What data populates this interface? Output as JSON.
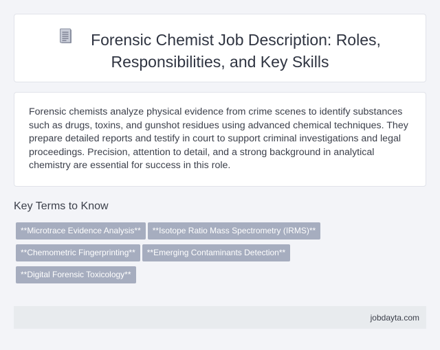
{
  "header": {
    "icon": "document-icon",
    "title_line1": "Forensic Chemist Job Description: Roles,",
    "title_line2": "Responsibilities, and Key Skills"
  },
  "description": {
    "text": "Forensic chemists analyze physical evidence from crime scenes to identify substances such as drugs, toxins, and gunshot residues using advanced chemical techniques. They prepare detailed reports and testify in court to support criminal investigations and legal proceedings. Precision, attention to detail, and a strong background in analytical chemistry are essential for success in this role."
  },
  "key_terms": {
    "heading": "Key Terms to Know",
    "tags": [
      "**Microtrace Evidence Analysis**",
      "**Isotope Ratio Mass Spectrometry (IRMS)**",
      "**Chemometric Fingerprinting**",
      "**Emerging Contaminants Detection**",
      "**Digital Forensic Toxicology**"
    ]
  },
  "footer": {
    "site": "jobdayta.com"
  },
  "colors": {
    "background": "#f3f4f8",
    "tag_bg": "#a6adbf",
    "footer_bg": "#e8ebee"
  }
}
